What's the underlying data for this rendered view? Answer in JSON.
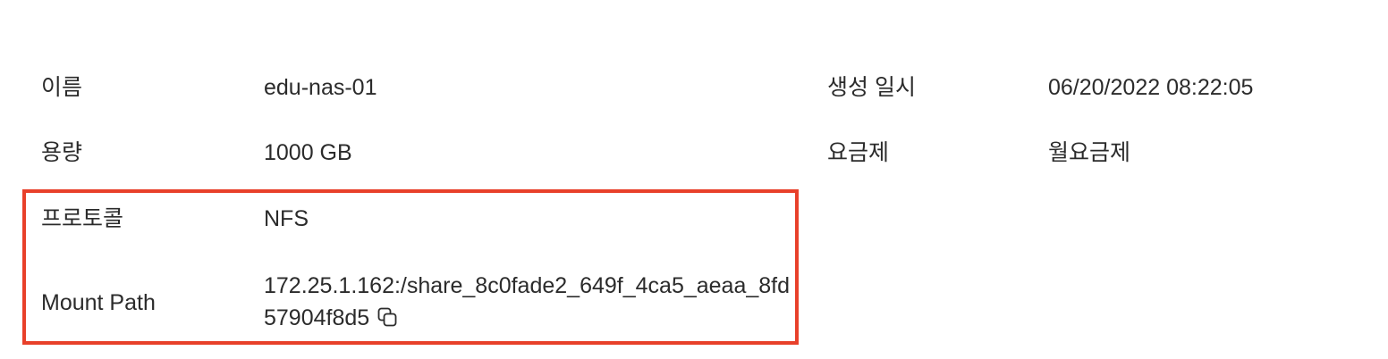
{
  "details": {
    "name_label": "이름",
    "name_value": "edu-nas-01",
    "created_label": "생성 일시",
    "created_value": "06/20/2022 08:22:05",
    "capacity_label": "용량",
    "capacity_value": "1000 GB",
    "billing_label": "요금제",
    "billing_value": "월요금제",
    "protocol_label": "프로토콜",
    "protocol_value": "NFS",
    "mount_label": "Mount Path",
    "mount_value": "172.25.1.162:/share_8c0fade2_649f_4ca5_aeaa_8fd57904f8d5"
  },
  "icons": {
    "copy": "copy-icon"
  },
  "colors": {
    "highlight": "#e8402a",
    "text": "#2b2b2b"
  }
}
